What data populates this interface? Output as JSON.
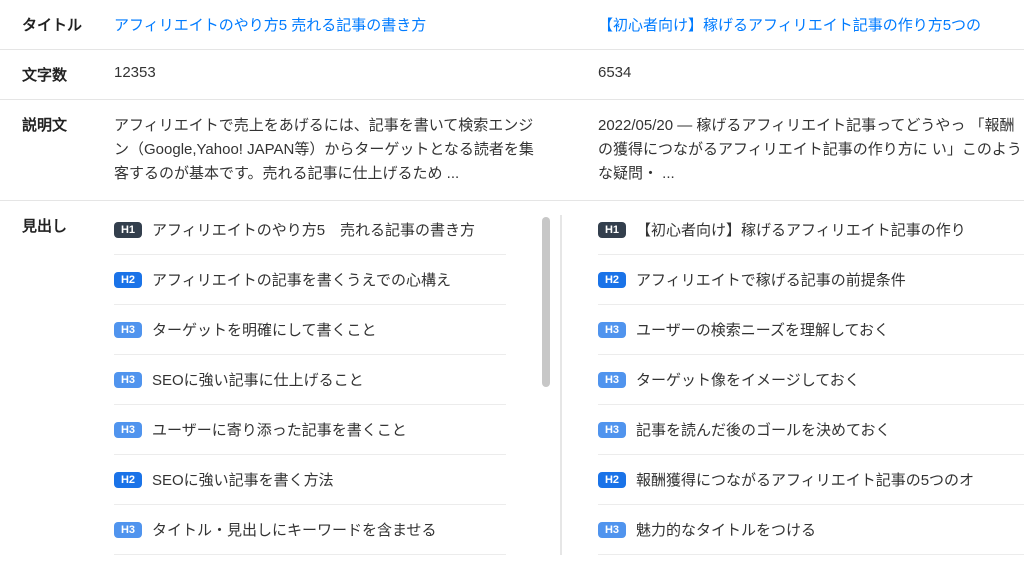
{
  "labels": {
    "title": "タイトル",
    "char_count": "文字数",
    "description": "説明文",
    "headings": "見出し"
  },
  "badge_labels": {
    "H1": "H1",
    "H2": "H2",
    "H3": "H3"
  },
  "col1": {
    "title": "アフィリエイトのやり方5 売れる記事の書き方",
    "char_count": "12353",
    "description": "アフィリエイトで売上をあげるには、記事を書いて検索エンジン（Google,Yahoo! JAPAN等）からターゲットとなる読者を集客するのが基本です。売れる記事に仕上げるため ...",
    "headings": [
      {
        "level": "H1",
        "text": "アフィリエイトのやり方5　売れる記事の書き方"
      },
      {
        "level": "H2",
        "text": "アフィリエイトの記事を書くうえでの心構え"
      },
      {
        "level": "H3",
        "text": "ターゲットを明確にして書くこと"
      },
      {
        "level": "H3",
        "text": "SEOに強い記事に仕上げること"
      },
      {
        "level": "H3",
        "text": "ユーザーに寄り添った記事を書くこと"
      },
      {
        "level": "H2",
        "text": "SEOに強い記事を書く方法"
      },
      {
        "level": "H3",
        "text": "タイトル・見出しにキーワードを含ませる"
      }
    ]
  },
  "col2": {
    "title": "【初心者向け】稼げるアフィリエイト記事の作り方5つの",
    "char_count": "6534",
    "description": "2022/05/20 — 稼げるアフィリエイト記事ってどうやっ 「報酬の獲得につながるアフィリエイト記事の作り方に い」このような疑問・ ...",
    "headings": [
      {
        "level": "H1",
        "text": "【初心者向け】稼げるアフィリエイト記事の作り"
      },
      {
        "level": "H2",
        "text": "アフィリエイトで稼げる記事の前提条件"
      },
      {
        "level": "H3",
        "text": "ユーザーの検索ニーズを理解しておく"
      },
      {
        "level": "H3",
        "text": "ターゲット像をイメージしておく"
      },
      {
        "level": "H3",
        "text": "記事を読んだ後のゴールを決めておく"
      },
      {
        "level": "H2",
        "text": "報酬獲得につながるアフィリエイト記事の5つのオ"
      },
      {
        "level": "H3",
        "text": "魅力的なタイトルをつける"
      }
    ]
  }
}
